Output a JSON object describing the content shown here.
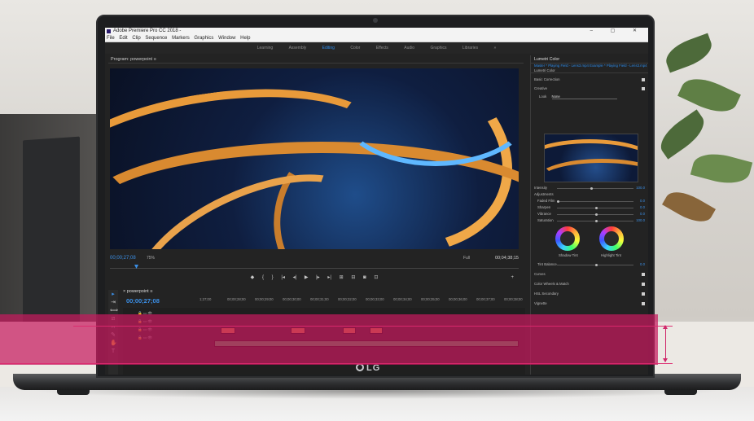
{
  "window": {
    "title": "Adobe Premiere Pro CC 2018 -",
    "controls": [
      "–",
      "▢",
      "✕"
    ]
  },
  "menu": [
    "File",
    "Edit",
    "Clip",
    "Sequence",
    "Markers",
    "Graphics",
    "Window",
    "Help"
  ],
  "workspaces": {
    "items": [
      "Learning",
      "Assembly",
      "Editing",
      "Color",
      "Effects",
      "Audio",
      "Graphics",
      "Libraries"
    ],
    "active": "Editing",
    "overflow": "»"
  },
  "program_monitor": {
    "title": "Program: powerpoint",
    "menu_icon": "≡",
    "timecode": "00;00;27;08",
    "zoom": "75%",
    "resolution": "Full",
    "duration": "00;04;38;15"
  },
  "transport": [
    "◆",
    "{",
    "}",
    "|◂",
    "◂|",
    "▶",
    "|▸",
    "▸|",
    "⊞",
    "⊟",
    "◙",
    "⊡"
  ],
  "transport_add": "+",
  "lumetri": {
    "title": "Lumetri Color",
    "source_tab": "Master * Playing Field - Lens3.mp4",
    "sequence_tab": "Example * Playing Field - Lens3.mp4",
    "effect": "Lumetri Color",
    "sections": {
      "basic": "Basic Correction",
      "creative": "Creative",
      "look_label": "Look",
      "look_value": "None",
      "intensity_label": "Intensity",
      "intensity_value": "100.0",
      "adjustments": "Adjustments",
      "faded_film_label": "Faded Film",
      "faded_film_value": "0.0",
      "sharpen_label": "Sharpen",
      "sharpen_value": "0.0",
      "vibrance_label": "Vibrance",
      "vibrance_value": "0.0",
      "saturation_label": "Saturation",
      "saturation_value": "100.0",
      "shadow_tint": "Shadow Tint",
      "highlight_tint": "Highlight Tint",
      "tint_balance_label": "Tint Balance",
      "tint_balance_value": "0.0",
      "curves": "Curves",
      "color_wheels": "Color Wheels & Match",
      "hsl": "HSL Secondary",
      "vignette": "Vignette"
    }
  },
  "timeline": {
    "title": "powerpoint",
    "menu_icon": "≡",
    "timecode": "00;00;27;08",
    "ruler": [
      "1;27;00",
      "00;00;28;00",
      "00;00;29;00",
      "00;00;30;00",
      "00;00;31;00",
      "00;00;32;00",
      "00;00;33;00",
      "00;00;34;00",
      "00;00;35;00",
      "00;00;36;00",
      "00;00;37;00",
      "00;00;38;00"
    ]
  },
  "laptop": {
    "brand": "LG"
  },
  "colors": {
    "accent": "#2d8ceb",
    "highlight_band": "#c61a5e",
    "clip_video": "#d48a3b",
    "clip_audio": "#3fa35b"
  }
}
